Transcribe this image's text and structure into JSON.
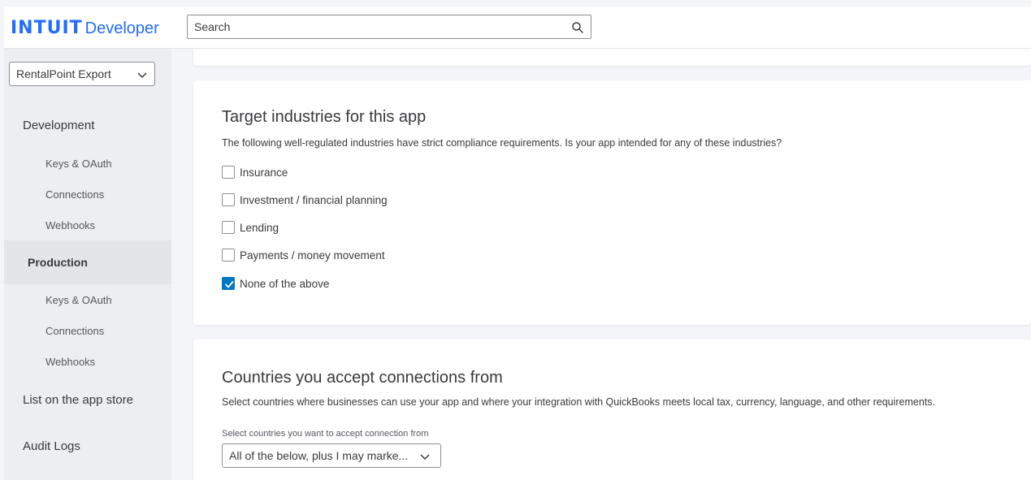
{
  "header": {
    "brand": "INTUIT",
    "product": "Developer",
    "search_placeholder": "Search"
  },
  "sidebar": {
    "app_selector": "RentalPoint Export",
    "development": {
      "label": "Development",
      "items": [
        "Keys & OAuth",
        "Connections",
        "Webhooks"
      ]
    },
    "production": {
      "label": "Production",
      "items": [
        "Keys & OAuth",
        "Connections",
        "Webhooks"
      ]
    },
    "list_on_app_store": "List on the app store",
    "audit_logs": "Audit Logs"
  },
  "industries": {
    "title": "Target industries for this app",
    "description": "The following well-regulated industries have strict compliance requirements. Is your app intended for any of these industries?",
    "options": [
      {
        "label": "Insurance",
        "checked": false
      },
      {
        "label": "Investment / financial planning",
        "checked": false
      },
      {
        "label": "Lending",
        "checked": false
      },
      {
        "label": "Payments / money movement",
        "checked": false
      },
      {
        "label": "None of the above",
        "checked": true
      }
    ]
  },
  "countries": {
    "title": "Countries you accept connections from",
    "description": "Select countries where businesses can use your app and where your integration with QuickBooks meets local tax, currency, language, and other requirements.",
    "field_label": "Select countries you want to accept connection from",
    "selected": "All of the below, plus I may marke..."
  },
  "colors": {
    "accent": "#236cff",
    "checkbox_checked": "#0077c5",
    "sidebar_bg": "#eceef1",
    "page_bg": "#f4f5f8"
  }
}
